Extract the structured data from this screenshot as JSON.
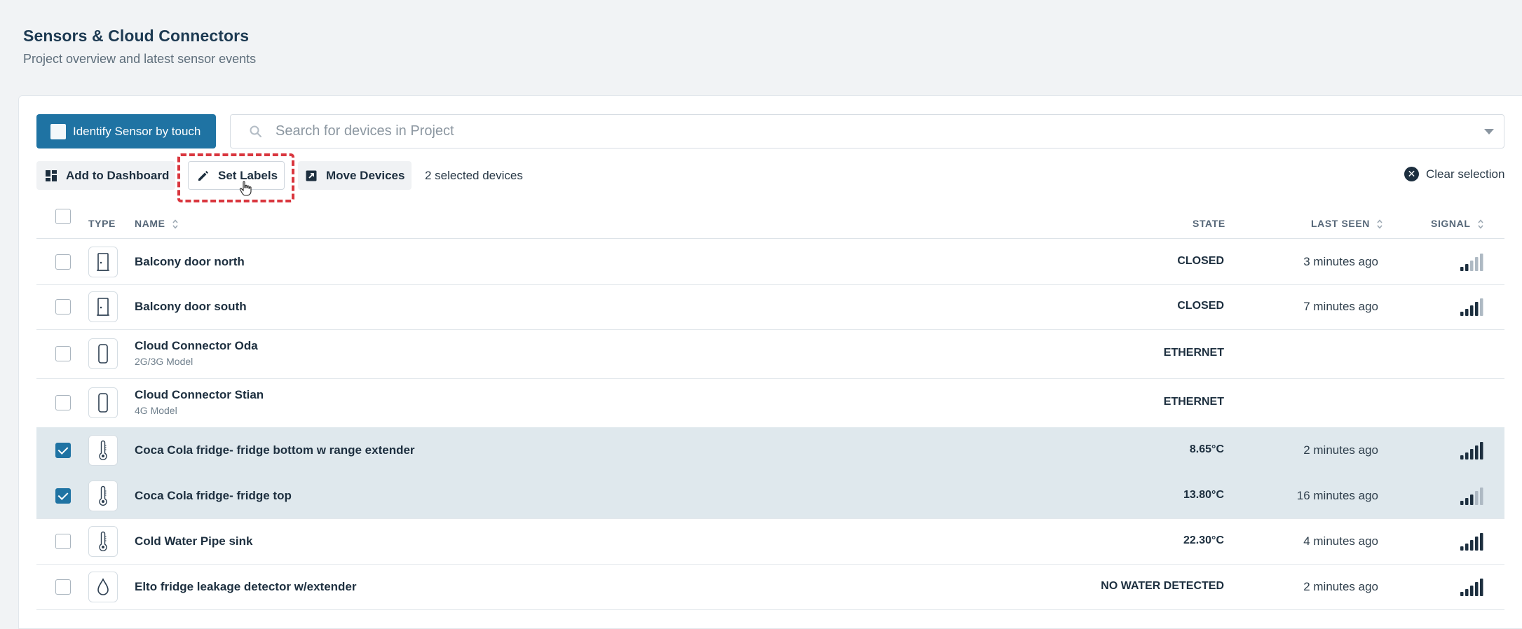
{
  "header": {
    "title": "Sensors & Cloud Connectors",
    "subtitle": "Project overview and latest sensor events"
  },
  "toolbar": {
    "identify_label": "Identify Sensor by touch",
    "search_placeholder": "Search for devices in Project",
    "add_dashboard_label": "Add to Dashboard",
    "set_labels_label": "Set Labels",
    "move_devices_label": "Move Devices",
    "selected_count": "2 selected devices",
    "clear_selection_label": "Clear selection"
  },
  "table": {
    "columns": {
      "type": "TYPE",
      "name": "NAME",
      "state": "STATE",
      "last_seen": "LAST SEEN",
      "signal": "SIGNAL"
    },
    "rows": [
      {
        "icon": "door-sensor-icon",
        "name": "Balcony door north",
        "sub": "",
        "state": "CLOSED",
        "last_seen": "3 minutes ago",
        "signal_level": 2,
        "selected": false
      },
      {
        "icon": "door-sensor-icon",
        "name": "Balcony door south",
        "sub": "",
        "state": "CLOSED",
        "last_seen": "7 minutes ago",
        "signal_level": 4,
        "selected": false
      },
      {
        "icon": "cloud-connector-icon",
        "name": "Cloud Connector Oda",
        "sub": "2G/3G Model",
        "state": "ETHERNET",
        "last_seen": "",
        "signal_level": 0,
        "selected": false
      },
      {
        "icon": "cloud-connector-icon",
        "name": "Cloud Connector Stian",
        "sub": "4G Model",
        "state": "ETHERNET",
        "last_seen": "",
        "signal_level": 0,
        "selected": false
      },
      {
        "icon": "thermometer-icon",
        "name": "Coca Cola fridge- fridge bottom w range extender",
        "sub": "",
        "state": "8.65°C",
        "last_seen": "2 minutes ago",
        "signal_level": 5,
        "selected": true
      },
      {
        "icon": "thermometer-icon",
        "name": "Coca Cola fridge- fridge top",
        "sub": "",
        "state": "13.80°C",
        "last_seen": "16 minutes ago",
        "signal_level": 3,
        "selected": true
      },
      {
        "icon": "thermometer-icon",
        "name": "Cold Water Pipe sink",
        "sub": "",
        "state": "22.30°C",
        "last_seen": "4 minutes ago",
        "signal_level": 5,
        "selected": false
      },
      {
        "icon": "water-drop-icon",
        "name": "Elto fridge leakage detector w/extender",
        "sub": "",
        "state": "NO WATER DETECTED",
        "last_seen": "2 minutes ago",
        "signal_level": 5,
        "selected": false
      }
    ]
  },
  "colors": {
    "primary": "#1f73a3",
    "highlight": "#d9363e",
    "selected_row": "#dfe8ed"
  }
}
